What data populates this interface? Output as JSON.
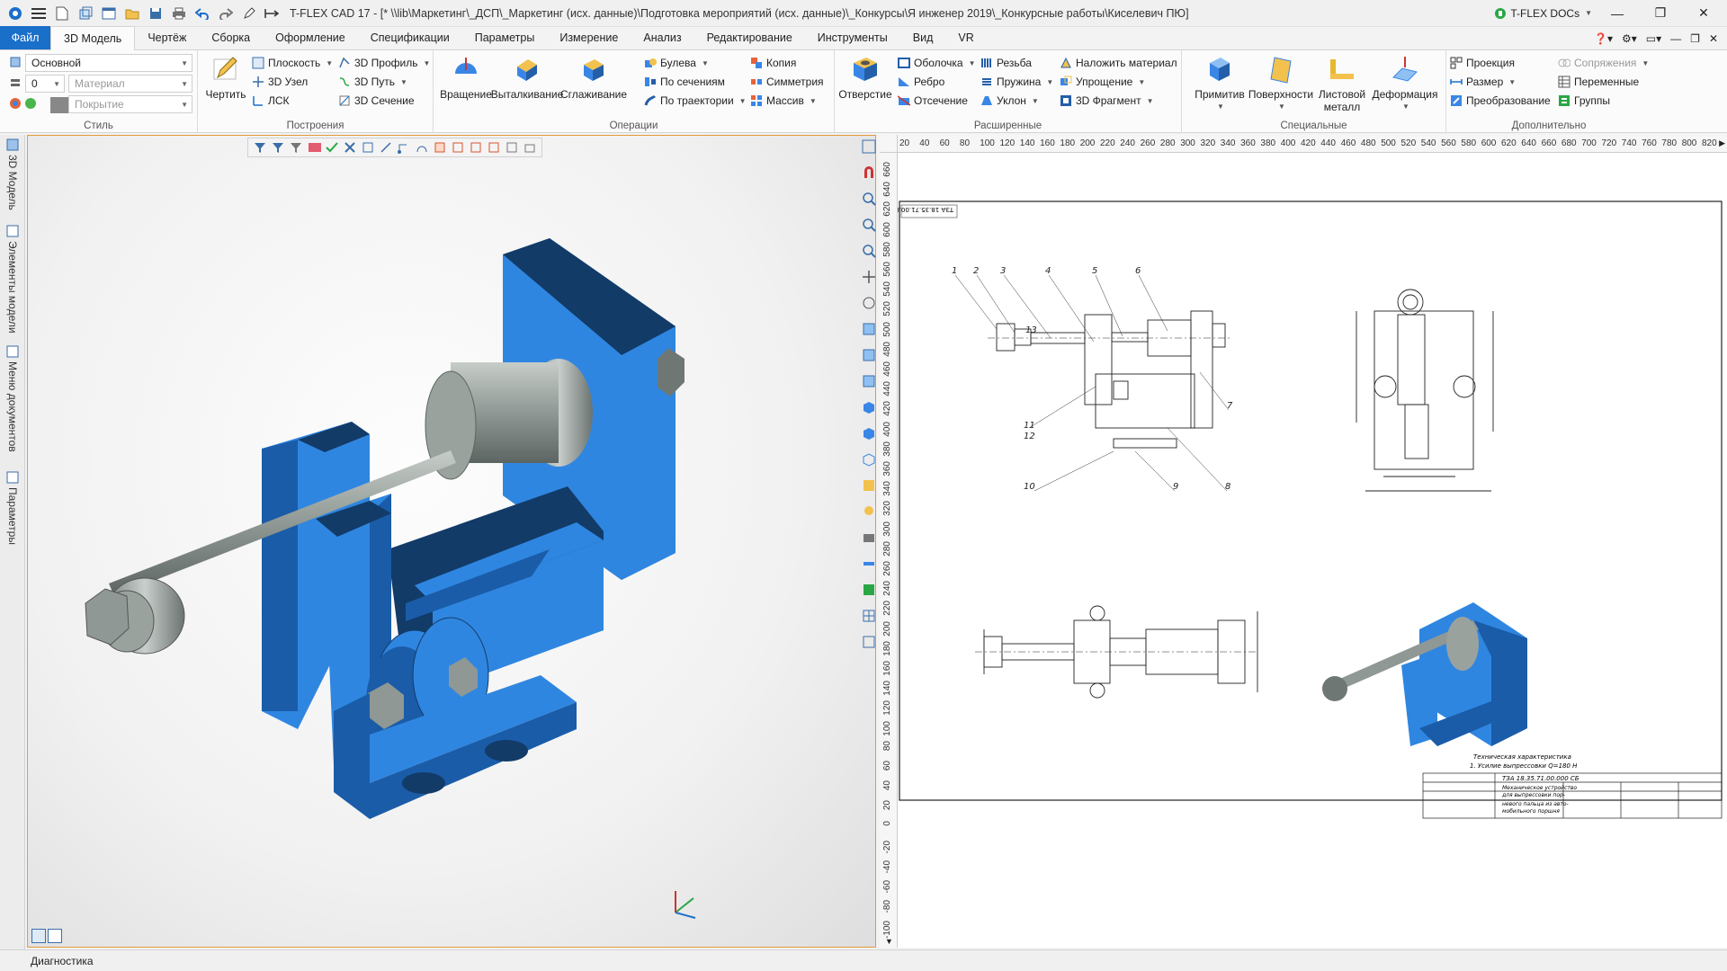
{
  "titlebar": {
    "title": "T-FLEX CAD 17 - [* \\\\lib\\Маркетинг\\_ДСП\\_Маркетинг (исх. данные)\\Подготовка мероприятий (исх. данные)\\_Конкурсы\\Я инженер 2019\\_Конкурсные работы\\Киселевич ПЮ]",
    "docs_label": "T-FLEX DOCs"
  },
  "menu": {
    "file": "Файл",
    "tabs": [
      "3D Модель",
      "Чертёж",
      "Сборка",
      "Оформление",
      "Спецификации",
      "Параметры",
      "Измерение",
      "Анализ",
      "Редактирование",
      "Инструменты",
      "Вид",
      "VR"
    ]
  },
  "ribbon": {
    "style": {
      "label": "Стиль",
      "layer": "Основной",
      "level": "0",
      "material_ph": "Материал",
      "cover_ph": "Покрытие"
    },
    "build": {
      "label": "Построения",
      "draw": "Чертить",
      "plane": "Плоскость",
      "node": "3D Узел",
      "lsk": "ЛСК",
      "profile": "3D Профиль",
      "path": "3D Путь",
      "section": "3D Сечение"
    },
    "ops": {
      "label": "Операции",
      "rotate": "Вращение",
      "extrude": "Выталкивание",
      "smooth": "Сглаживание",
      "boolean": "Булева",
      "sections": "По сечениям",
      "trajectory": "По траектории",
      "copy": "Копия",
      "symmetry": "Симметрия",
      "array": "Массив"
    },
    "ext": {
      "label": "Расширенные",
      "hole": "Отверстие",
      "shell": "Оболочка",
      "rib": "Ребро",
      "cut": "Отсечение",
      "thread": "Резьба",
      "spring": "Пружина",
      "slope": "Уклон",
      "material": "Наложить материал",
      "simplify": "Упрощение",
      "fragment": "3D Фрагмент"
    },
    "special": {
      "label": "Специальные",
      "primitive": "Примитив",
      "surfaces": "Поверхности",
      "sheet_metal_1": "Листовой",
      "sheet_metal_2": "металл",
      "deform": "Деформация"
    },
    "extra": {
      "label": "Дополнительно",
      "projection": "Проекция",
      "size": "Размер",
      "transform": "Преобразование",
      "mates": "Сопряжения",
      "vars": "Переменные",
      "groups": "Группы"
    }
  },
  "sidetabs": [
    "3D Модель",
    "Элементы модели",
    "Меню документов",
    "Параметры"
  ],
  "ruler": {
    "h": [
      "20",
      "40",
      "60",
      "80",
      "100",
      "120",
      "140",
      "160",
      "180",
      "200",
      "220",
      "240",
      "260",
      "280",
      "300",
      "320",
      "340",
      "360",
      "380",
      "400",
      "420",
      "440",
      "460",
      "480",
      "500",
      "520",
      "540",
      "560",
      "580",
      "600",
      "620",
      "640",
      "660",
      "680",
      "700",
      "720",
      "740",
      "760",
      "780",
      "800",
      "820"
    ],
    "v": [
      "660",
      "640",
      "620",
      "600",
      "580",
      "560",
      "540",
      "520",
      "500",
      "480",
      "460",
      "440",
      "420",
      "400",
      "380",
      "360",
      "340",
      "320",
      "300",
      "280",
      "260",
      "240",
      "220",
      "200",
      "180",
      "160",
      "140",
      "120",
      "100",
      "80",
      "60",
      "40",
      "20",
      "0",
      "-20",
      "-40",
      "-60",
      "-80",
      "-100"
    ]
  },
  "drawing": {
    "stamp_code": "ТЗА 18.35.71.00.000 СБ",
    "balloons": [
      "1",
      "2",
      "3",
      "4",
      "5",
      "6",
      "7",
      "8",
      "9",
      "10",
      "11",
      "12",
      "13"
    ],
    "tech_1": "Техническая характеристика",
    "tech_2": "1. Усилие выпрессовки Q=180 Н",
    "title_block_1": "Механическое устройство",
    "title_block_2": "для выпрессовки пор-",
    "title_block_3": "невого пальца из авто-",
    "title_block_4": "мобильного поршня"
  },
  "status": {
    "text": "Диагностика"
  },
  "colors": {
    "accent": "#1a6fc9",
    "part_blue": "#2f86e0",
    "part_dark": "#123b68",
    "steel": "#8f9894"
  }
}
